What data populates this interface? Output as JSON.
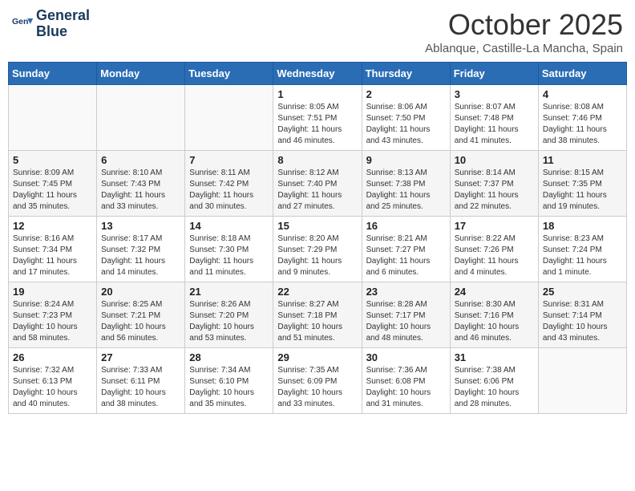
{
  "header": {
    "logo_line1": "General",
    "logo_line2": "Blue",
    "title": "October 2025",
    "subtitle": "Ablanque, Castille-La Mancha, Spain"
  },
  "weekdays": [
    "Sunday",
    "Monday",
    "Tuesday",
    "Wednesday",
    "Thursday",
    "Friday",
    "Saturday"
  ],
  "weeks": [
    [
      {
        "day": "",
        "detail": ""
      },
      {
        "day": "",
        "detail": ""
      },
      {
        "day": "",
        "detail": ""
      },
      {
        "day": "1",
        "detail": "Sunrise: 8:05 AM\nSunset: 7:51 PM\nDaylight: 11 hours\nand 46 minutes."
      },
      {
        "day": "2",
        "detail": "Sunrise: 8:06 AM\nSunset: 7:50 PM\nDaylight: 11 hours\nand 43 minutes."
      },
      {
        "day": "3",
        "detail": "Sunrise: 8:07 AM\nSunset: 7:48 PM\nDaylight: 11 hours\nand 41 minutes."
      },
      {
        "day": "4",
        "detail": "Sunrise: 8:08 AM\nSunset: 7:46 PM\nDaylight: 11 hours\nand 38 minutes."
      }
    ],
    [
      {
        "day": "5",
        "detail": "Sunrise: 8:09 AM\nSunset: 7:45 PM\nDaylight: 11 hours\nand 35 minutes."
      },
      {
        "day": "6",
        "detail": "Sunrise: 8:10 AM\nSunset: 7:43 PM\nDaylight: 11 hours\nand 33 minutes."
      },
      {
        "day": "7",
        "detail": "Sunrise: 8:11 AM\nSunset: 7:42 PM\nDaylight: 11 hours\nand 30 minutes."
      },
      {
        "day": "8",
        "detail": "Sunrise: 8:12 AM\nSunset: 7:40 PM\nDaylight: 11 hours\nand 27 minutes."
      },
      {
        "day": "9",
        "detail": "Sunrise: 8:13 AM\nSunset: 7:38 PM\nDaylight: 11 hours\nand 25 minutes."
      },
      {
        "day": "10",
        "detail": "Sunrise: 8:14 AM\nSunset: 7:37 PM\nDaylight: 11 hours\nand 22 minutes."
      },
      {
        "day": "11",
        "detail": "Sunrise: 8:15 AM\nSunset: 7:35 PM\nDaylight: 11 hours\nand 19 minutes."
      }
    ],
    [
      {
        "day": "12",
        "detail": "Sunrise: 8:16 AM\nSunset: 7:34 PM\nDaylight: 11 hours\nand 17 minutes."
      },
      {
        "day": "13",
        "detail": "Sunrise: 8:17 AM\nSunset: 7:32 PM\nDaylight: 11 hours\nand 14 minutes."
      },
      {
        "day": "14",
        "detail": "Sunrise: 8:18 AM\nSunset: 7:30 PM\nDaylight: 11 hours\nand 11 minutes."
      },
      {
        "day": "15",
        "detail": "Sunrise: 8:20 AM\nSunset: 7:29 PM\nDaylight: 11 hours\nand 9 minutes."
      },
      {
        "day": "16",
        "detail": "Sunrise: 8:21 AM\nSunset: 7:27 PM\nDaylight: 11 hours\nand 6 minutes."
      },
      {
        "day": "17",
        "detail": "Sunrise: 8:22 AM\nSunset: 7:26 PM\nDaylight: 11 hours\nand 4 minutes."
      },
      {
        "day": "18",
        "detail": "Sunrise: 8:23 AM\nSunset: 7:24 PM\nDaylight: 11 hours\nand 1 minute."
      }
    ],
    [
      {
        "day": "19",
        "detail": "Sunrise: 8:24 AM\nSunset: 7:23 PM\nDaylight: 10 hours\nand 58 minutes."
      },
      {
        "day": "20",
        "detail": "Sunrise: 8:25 AM\nSunset: 7:21 PM\nDaylight: 10 hours\nand 56 minutes."
      },
      {
        "day": "21",
        "detail": "Sunrise: 8:26 AM\nSunset: 7:20 PM\nDaylight: 10 hours\nand 53 minutes."
      },
      {
        "day": "22",
        "detail": "Sunrise: 8:27 AM\nSunset: 7:18 PM\nDaylight: 10 hours\nand 51 minutes."
      },
      {
        "day": "23",
        "detail": "Sunrise: 8:28 AM\nSunset: 7:17 PM\nDaylight: 10 hours\nand 48 minutes."
      },
      {
        "day": "24",
        "detail": "Sunrise: 8:30 AM\nSunset: 7:16 PM\nDaylight: 10 hours\nand 46 minutes."
      },
      {
        "day": "25",
        "detail": "Sunrise: 8:31 AM\nSunset: 7:14 PM\nDaylight: 10 hours\nand 43 minutes."
      }
    ],
    [
      {
        "day": "26",
        "detail": "Sunrise: 7:32 AM\nSunset: 6:13 PM\nDaylight: 10 hours\nand 40 minutes."
      },
      {
        "day": "27",
        "detail": "Sunrise: 7:33 AM\nSunset: 6:11 PM\nDaylight: 10 hours\nand 38 minutes."
      },
      {
        "day": "28",
        "detail": "Sunrise: 7:34 AM\nSunset: 6:10 PM\nDaylight: 10 hours\nand 35 minutes."
      },
      {
        "day": "29",
        "detail": "Sunrise: 7:35 AM\nSunset: 6:09 PM\nDaylight: 10 hours\nand 33 minutes."
      },
      {
        "day": "30",
        "detail": "Sunrise: 7:36 AM\nSunset: 6:08 PM\nDaylight: 10 hours\nand 31 minutes."
      },
      {
        "day": "31",
        "detail": "Sunrise: 7:38 AM\nSunset: 6:06 PM\nDaylight: 10 hours\nand 28 minutes."
      },
      {
        "day": "",
        "detail": ""
      }
    ]
  ]
}
